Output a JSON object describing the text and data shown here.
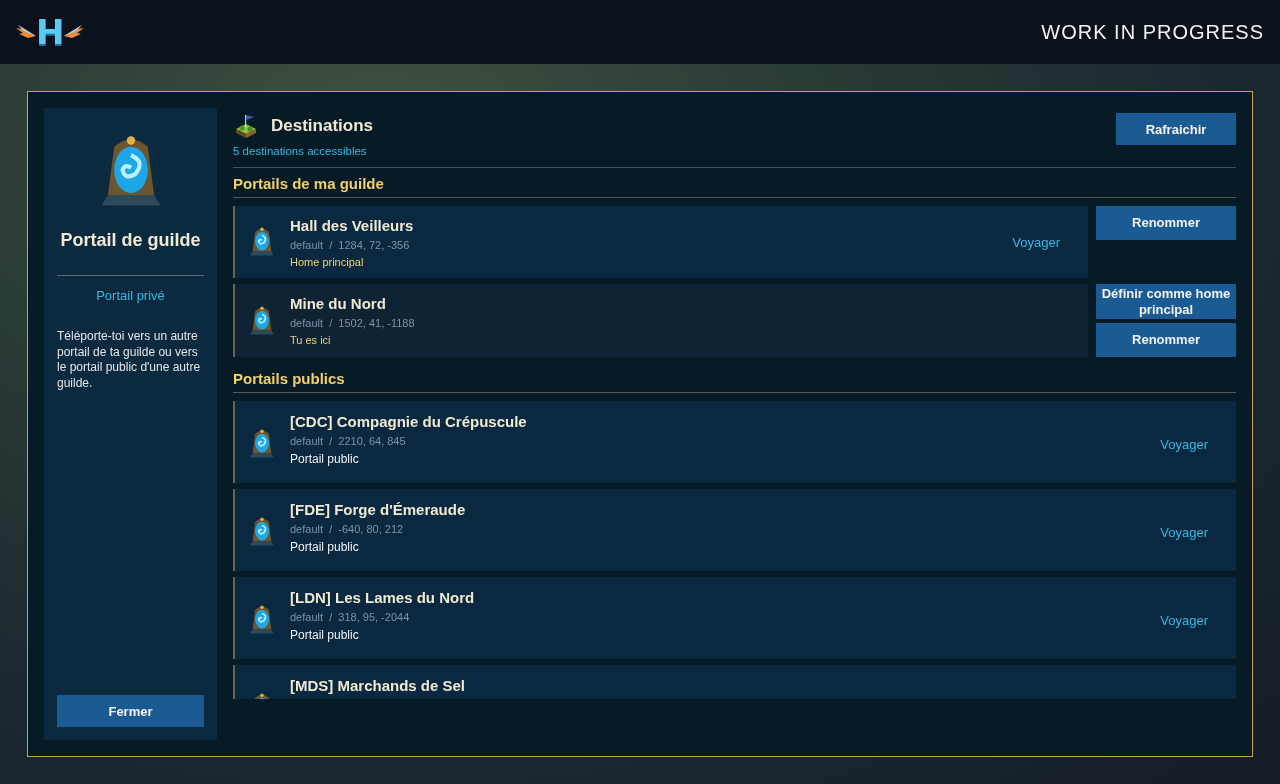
{
  "header": {
    "logo": "H",
    "title": "WORK IN PROGRESS"
  },
  "sidebar": {
    "title": "Portail de guilde",
    "type": "Portail privé",
    "description": "Téléporte-toi vers un autre portail de ta guilde ou vers le portail public d'une autre guilde.",
    "close_button": "Fermer"
  },
  "destinations": {
    "title": "Destinations",
    "count": "5 destinations accessibles",
    "refresh_button": "Rafraichir"
  },
  "guild_section": {
    "title": "Portails de ma guilde",
    "portals": [
      {
        "name": "Hall des Veilleurs",
        "location": "default  /  1284, 72, -356",
        "status": "Home principal",
        "current": false,
        "action": "Voyager",
        "buttons": [
          "Renommer"
        ]
      },
      {
        "name": "Mine du Nord",
        "location": "default  /  1502, 41, -1188",
        "status": "Tu es ici",
        "current": true,
        "buttons": [
          "Définir comme home principal",
          "Renommer"
        ]
      }
    ]
  },
  "public_section": {
    "title": "Portails publics",
    "portals": [
      {
        "name": "[CDC] Compagnie du Crépuscule",
        "location": "default  /  2210, 64, 845",
        "status": "Portail public",
        "action": "Voyager"
      },
      {
        "name": "[FDE] Forge d'Émeraude",
        "location": "default  /  -640, 80, 212",
        "status": "Portail public",
        "action": "Voyager"
      },
      {
        "name": "[LDN] Les Lames du Nord",
        "location": "default  /  318, 95, -2044",
        "status": "Portail public",
        "action": "Voyager"
      },
      {
        "name": "[MDS] Marchands de Sel"
      }
    ]
  }
}
